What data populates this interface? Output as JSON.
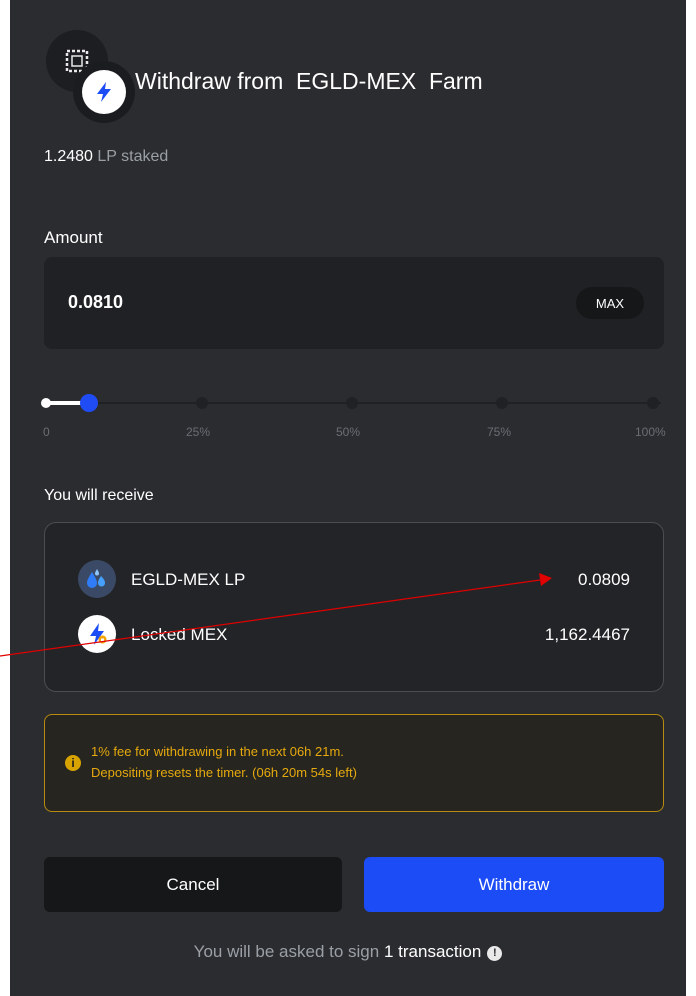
{
  "dialog": {
    "title_prefix": "Withdraw from",
    "farm_name": "EGLD-MEX",
    "title_suffix": "Farm"
  },
  "staked": {
    "amount": "1.2480",
    "unit": "LP staked"
  },
  "amount": {
    "label": "Amount",
    "value": "0.0810",
    "max_label": "MAX"
  },
  "slider": {
    "value_percent": 6.5,
    "ticks": [
      "0",
      "25%",
      "50%",
      "75%",
      "100%"
    ]
  },
  "receive": {
    "label": "You will receive",
    "items": [
      {
        "name": "EGLD-MEX LP",
        "value": "0.0809",
        "icon": "egld-mex-lp-drops-icon"
      },
      {
        "name": "Locked MEX",
        "value": "1,162.4467",
        "icon": "locked-mex-bolt-icon"
      }
    ]
  },
  "warning": {
    "icon": "info-circle-icon",
    "line1": "1% fee for withdrawing in the next 06h 21m.",
    "line2": "Depositing resets the timer. (06h 20m 54s left)"
  },
  "buttons": {
    "cancel": "Cancel",
    "withdraw": "Withdraw"
  },
  "sign_note": {
    "prefix": "You will be asked to sign",
    "count": "1 transaction"
  },
  "colors": {
    "modal_bg": "#2b2c30",
    "accent_blue": "#1b4cf5",
    "warning": "#e6a90e",
    "annotation_red": "#e00000"
  }
}
